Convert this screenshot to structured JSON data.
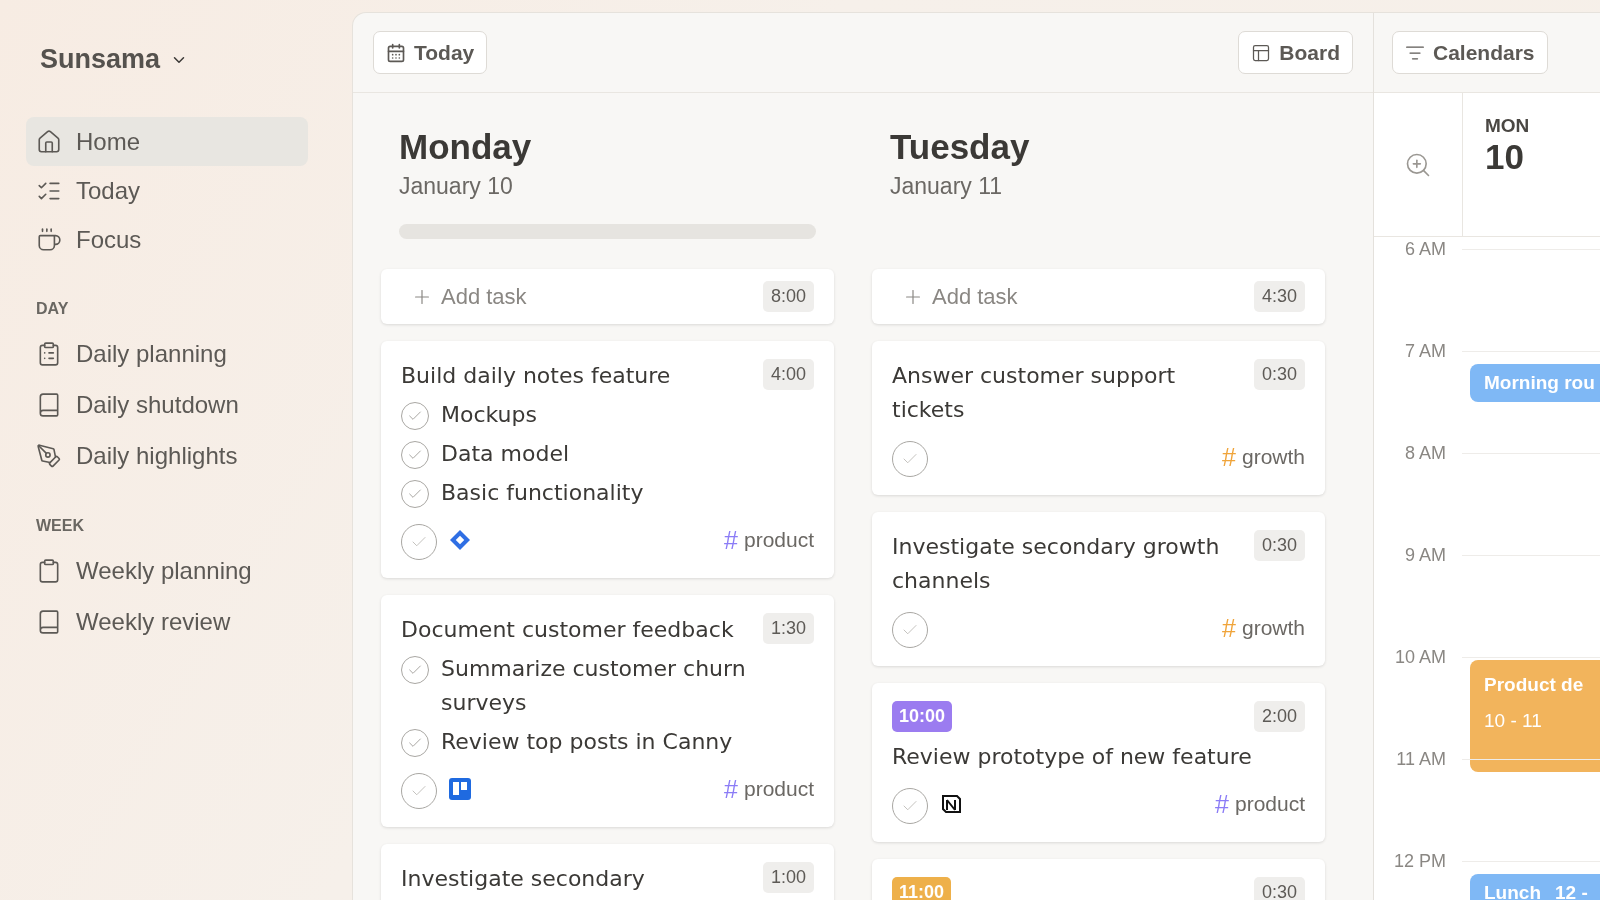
{
  "sidebar": {
    "workspace": "Sunsama",
    "nav": [
      {
        "label": "Home",
        "kind": "home",
        "selected": true
      },
      {
        "label": "Today",
        "kind": "list",
        "selected": false
      },
      {
        "label": "Focus",
        "kind": "cup",
        "selected": false
      }
    ],
    "sections": [
      {
        "title": "DAY",
        "items": [
          {
            "label": "Daily planning",
            "kind": "clipboardlist",
            "selected": false
          },
          {
            "label": "Daily shutdown",
            "kind": "book",
            "selected": false
          },
          {
            "label": "Daily highlights",
            "kind": "pen",
            "selected": false
          }
        ]
      },
      {
        "title": "WEEK",
        "items": [
          {
            "label": "Weekly planning",
            "kind": "clipboard",
            "selected": false
          },
          {
            "label": "Weekly review",
            "kind": "book",
            "selected": false
          }
        ]
      }
    ]
  },
  "toolbar": {
    "today_button": "Today",
    "board_button": "Board"
  },
  "days": [
    {
      "weekday": "Monday",
      "date": "January 10",
      "progress": {
        "level": 0
      },
      "add_task": {
        "label": "Add task",
        "time": "8:00"
      },
      "tasks": [
        {
          "title": "Build daily notes feature",
          "duration": "4:00",
          "checked": false,
          "kind": "jira",
          "channel": {
            "hash": "#",
            "name": "product",
            "color": "#8b7cf6"
          },
          "subtasks": [
            {
              "title": "Mockups",
              "checked": false
            },
            {
              "title": "Data model",
              "checked": false
            },
            {
              "title": "Basic functionality",
              "checked": false
            }
          ]
        },
        {
          "title": "Document customer feedback",
          "duration": "1:30",
          "checked": false,
          "kind": "trello",
          "channel": {
            "hash": "#",
            "name": "product",
            "color": "#8b7cf6"
          },
          "subtasks": [
            {
              "title": "Summarize customer churn surveys",
              "checked": false
            },
            {
              "title": "Review top posts in Canny",
              "checked": false
            }
          ]
        },
        {
          "title": "Investigate secondary",
          "duration": "1:00"
        }
      ]
    },
    {
      "weekday": "Tuesday",
      "date": "January 11",
      "add_task": {
        "label": "Add task",
        "time": "4:30"
      },
      "tasks": [
        {
          "title": "Answer customer support tickets",
          "duration": "0:30",
          "checked": false,
          "channel": {
            "hash": "#",
            "name": "growth",
            "color": "#f0a43a"
          }
        },
        {
          "title": "Investigate secondary growth channels",
          "duration": "0:30",
          "checked": false,
          "channel": {
            "hash": "#",
            "name": "growth",
            "color": "#f0a43a"
          }
        },
        {
          "start_time": {
            "label": "10:00",
            "color": "#9b7cf0"
          },
          "title": "Review prototype of new feature",
          "duration": "2:00",
          "checked": false,
          "kind": "notion",
          "channel": {
            "hash": "#",
            "name": "product",
            "color": "#8b7cf6"
          }
        },
        {
          "start_time": {
            "label": "11:00",
            "color": "#eeb04a"
          },
          "duration": "0:30"
        }
      ]
    }
  ],
  "calendar": {
    "button": "Calendars",
    "day": {
      "weekday": "MON",
      "date": "10"
    },
    "hours": [
      {
        "label": "6 AM"
      },
      {
        "label": "7 AM",
        "events": [
          {
            "title": "Morning rou",
            "kind": "bar",
            "color": "#7fb8f5"
          }
        ]
      },
      {
        "label": "8 AM"
      },
      {
        "label": "9 AM"
      },
      {
        "label": "10 AM",
        "events": [
          {
            "title": "Product de",
            "time": "10 - 11",
            "kind": "block",
            "color": "#f2b45c"
          }
        ]
      },
      {
        "label": "11 AM"
      },
      {
        "label": "12 PM",
        "events": [
          {
            "title": "Lunch",
            "time": "12 -",
            "kind": "bar",
            "color": "#7fb8f5"
          }
        ]
      }
    ]
  }
}
